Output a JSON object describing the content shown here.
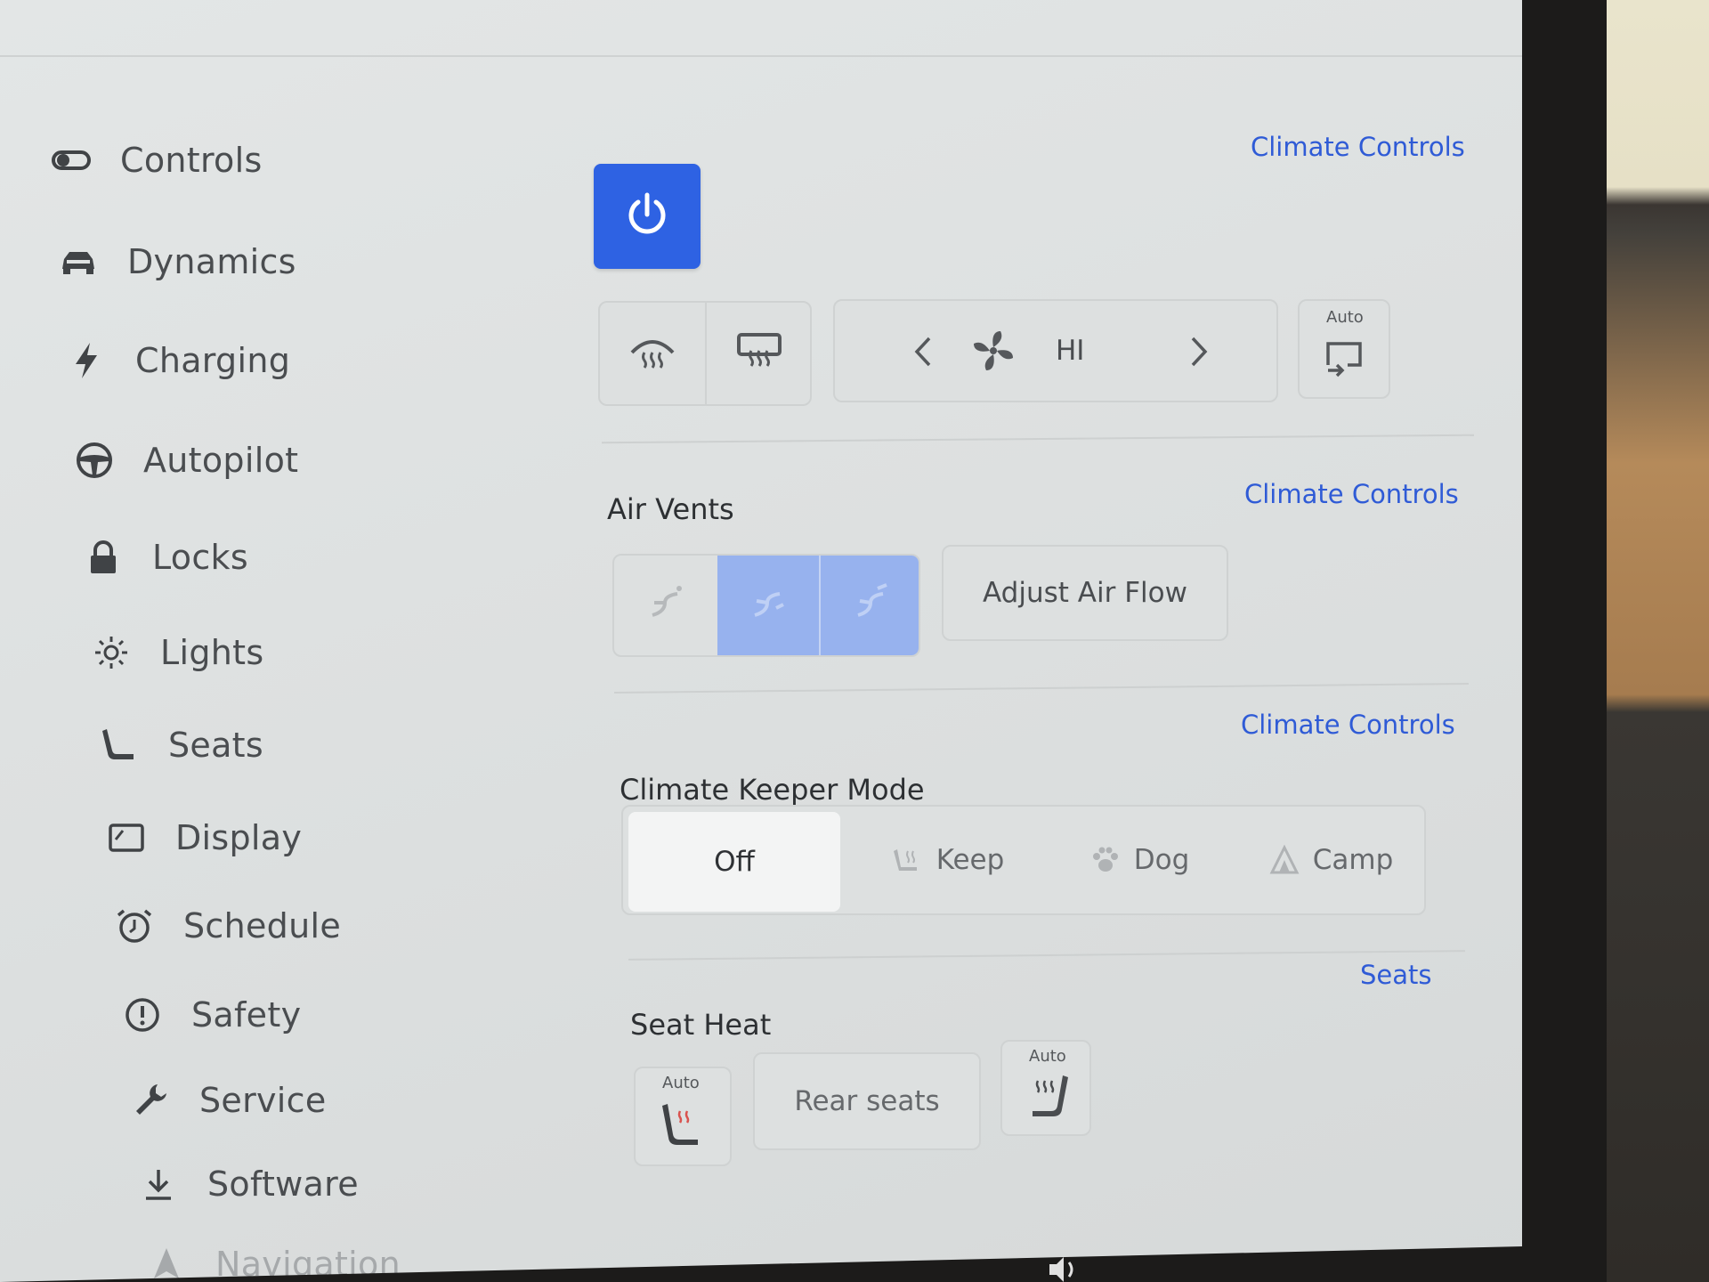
{
  "sidebar": {
    "items": [
      {
        "label": "Controls",
        "icon": "toggle-icon"
      },
      {
        "label": "Dynamics",
        "icon": "car-icon"
      },
      {
        "label": "Charging",
        "icon": "lightning-icon"
      },
      {
        "label": "Autopilot",
        "icon": "steering-wheel-icon"
      },
      {
        "label": "Locks",
        "icon": "lock-icon"
      },
      {
        "label": "Lights",
        "icon": "sun-icon"
      },
      {
        "label": "Seats",
        "icon": "seat-icon"
      },
      {
        "label": "Display",
        "icon": "display-icon"
      },
      {
        "label": "Schedule",
        "icon": "alarm-clock-icon"
      },
      {
        "label": "Safety",
        "icon": "alert-circle-icon"
      },
      {
        "label": "Service",
        "icon": "wrench-icon"
      },
      {
        "label": "Software",
        "icon": "download-icon"
      },
      {
        "label": "Navigation",
        "icon": "navigation-arrow-icon"
      }
    ]
  },
  "climate": {
    "link": "Climate Controls",
    "fan": {
      "level": "HI",
      "auto_label": "Auto"
    },
    "defrost": [
      "front-defrost-icon",
      "rear-defrost-icon"
    ]
  },
  "air_vents": {
    "title": "Air Vents",
    "link": "Climate Controls",
    "adjust_label": "Adjust Air Flow"
  },
  "keeper": {
    "title": "Climate Keeper Mode",
    "link": "Climate Controls",
    "options": [
      "Off",
      "Keep",
      "Dog",
      "Camp"
    ],
    "selected": "Off"
  },
  "seat_heat": {
    "title": "Seat Heat",
    "link": "Seats",
    "auto_left": "Auto",
    "rear_label": "Rear seats",
    "auto_right": "Auto"
  },
  "colors": {
    "accent": "#2e62e3",
    "link": "#2f5bd6",
    "vent_active": "#97b2ee"
  }
}
